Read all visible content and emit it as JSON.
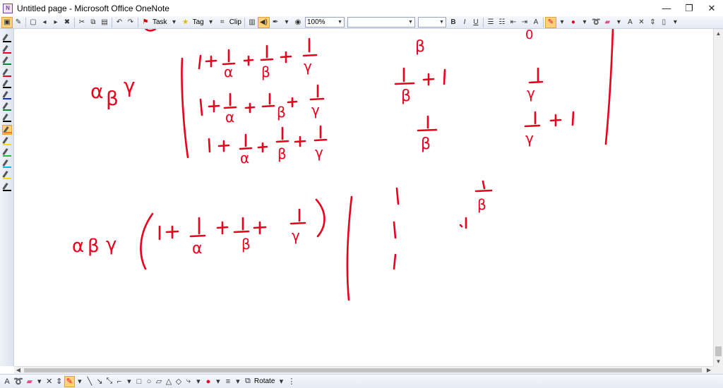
{
  "window": {
    "title": "Untitled page - Microsoft Office OneNote",
    "minimize": "—",
    "maximize": "❐",
    "close": "✕"
  },
  "toolbar": {
    "task_label": "Task",
    "tag_label": "Tag",
    "clip_label": "Clip",
    "zoom_value": "100%",
    "font_name_value": "",
    "font_size_value": ""
  },
  "bottombar": {
    "rotate_label": "Rotate"
  },
  "pens": [
    {
      "name": "black",
      "color": "#000000"
    },
    {
      "name": "red",
      "color": "#e8001c"
    },
    {
      "name": "green",
      "color": "#0a8a2a"
    },
    {
      "name": "red-2",
      "color": "#e8001c"
    },
    {
      "name": "black-2",
      "color": "#000000"
    },
    {
      "name": "blue",
      "color": "#1a2fd0"
    },
    {
      "name": "green-2",
      "color": "#0a8a2a"
    },
    {
      "name": "black-3",
      "color": "#000000"
    },
    {
      "name": "orange",
      "color": "#ff7a00"
    },
    {
      "name": "yellow",
      "color": "#f2e100"
    },
    {
      "name": "green-3",
      "color": "#22c03a"
    },
    {
      "name": "cyan",
      "color": "#00b7e8"
    },
    {
      "name": "yellow-2",
      "color": "#f2e100"
    },
    {
      "name": "black-4",
      "color": "#000000"
    }
  ],
  "ink": {
    "alpha": "α",
    "beta": "β",
    "gamma": "γ",
    "one": "1",
    "plus": "+"
  }
}
